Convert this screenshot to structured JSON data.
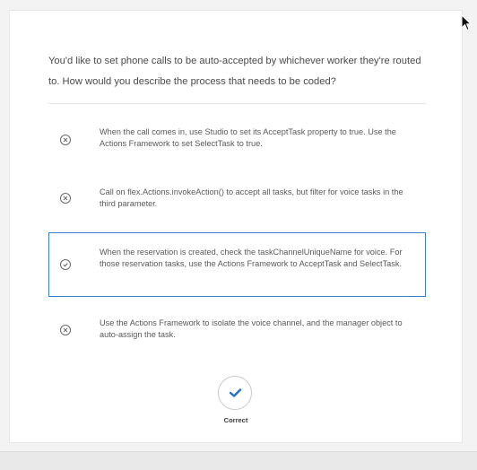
{
  "question": {
    "text": "You'd like to set phone calls to be auto-accepted by whichever worker they're routed to. How would you describe the process that needs to be coded?"
  },
  "options": [
    {
      "text": "When the call comes in, use Studio to set its AcceptTask property to true. Use the Actions Framework to set SelectTask to true.",
      "icon": "x-circle-icon",
      "selected": false
    },
    {
      "text": "Call on flex.Actions.invokeAction() to accept all tasks, but filter for voice tasks in the third parameter.",
      "icon": "x-circle-icon",
      "selected": false
    },
    {
      "text": "When the reservation is created, check the taskChannelUniqueName for voice. For those reservation tasks, use the Actions Framework to AcceptTask and SelectTask.",
      "icon": "check-circle-icon",
      "selected": true
    },
    {
      "text": "Use the Actions Framework to isolate the voice channel, and the manager object to auto-assign the task.",
      "icon": "x-circle-icon",
      "selected": false
    }
  ],
  "result": {
    "label": "Correct",
    "icon": "checkmark-icon",
    "accent_color": "#1f6fd1"
  },
  "colors": {
    "selected_border": "#3b7ec9",
    "text": "#5a5a5a"
  }
}
